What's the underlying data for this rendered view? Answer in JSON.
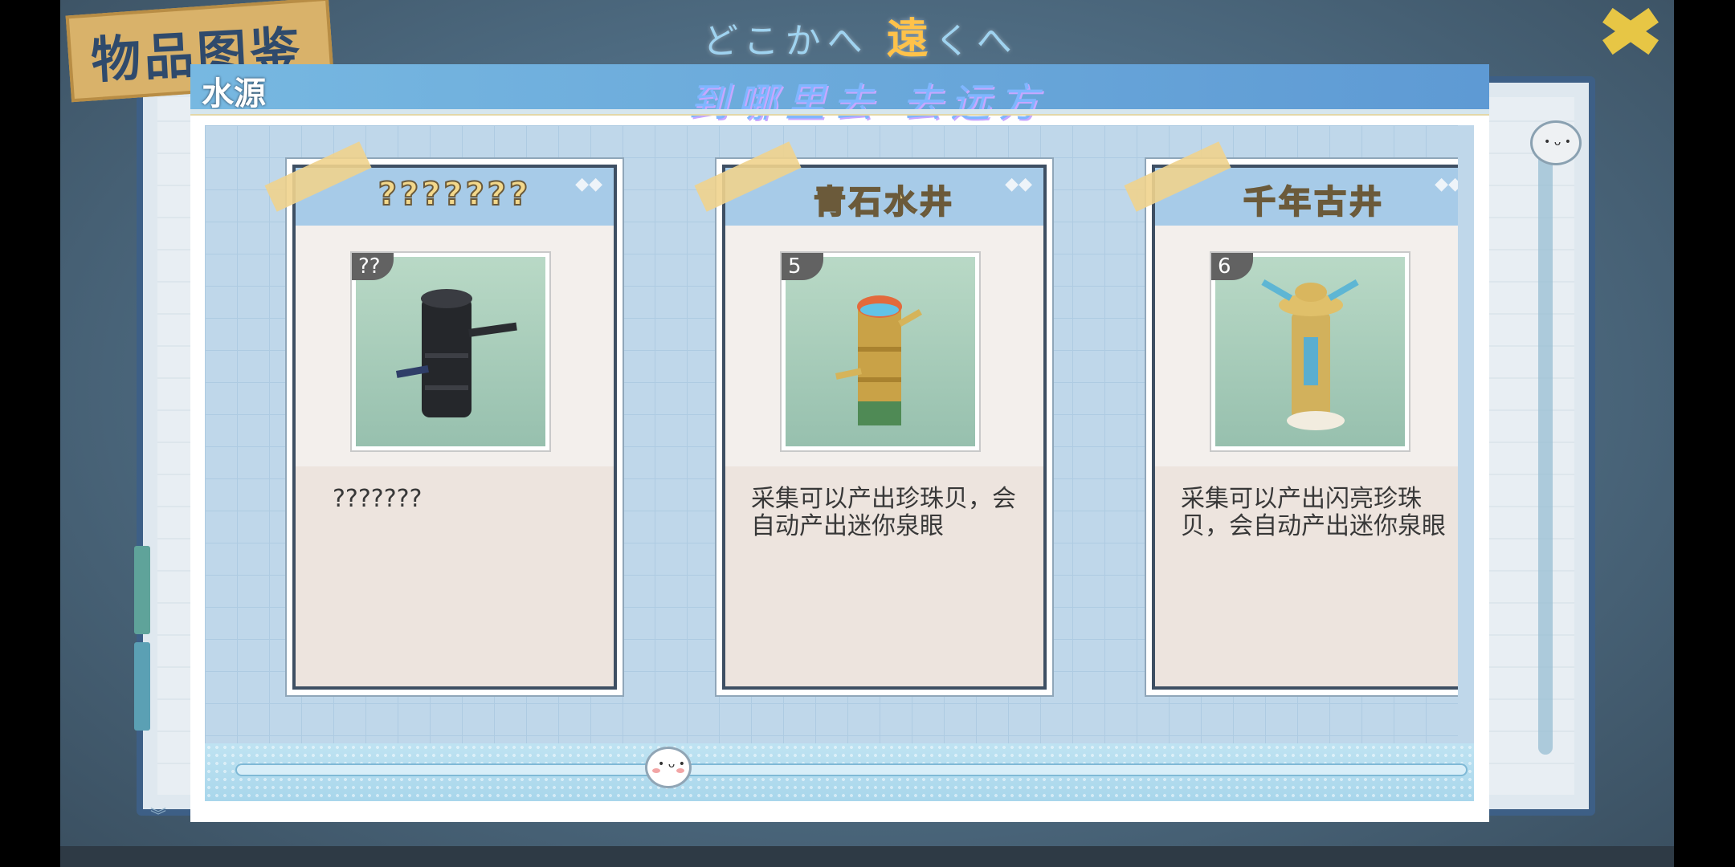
{
  "app": {
    "book_title": "物品图鉴",
    "song_jp": {
      "before": "どこかへ ",
      "highlight": "遠",
      "after": "くへ"
    },
    "song_cn": "到哪里去 去远方"
  },
  "dialog": {
    "title": "水源"
  },
  "cards": [
    {
      "name": "???????",
      "level": "??",
      "description": "???????",
      "locked": true
    },
    {
      "name": "青石水井",
      "level": "5",
      "description": "采集可以产出珍珠贝，会自动产出迷你泉眼",
      "locked": false
    },
    {
      "name": "千年古井",
      "level": "6",
      "description": "采集可以产出闪亮珍珠贝，会自动产出迷你泉眼",
      "locked": false
    }
  ],
  "slider": {
    "position_fraction": 0.33
  },
  "colors": {
    "header_blue": "#6aa9dc",
    "card_name_gold": "#f3d88b",
    "frame_navy": "#3e4f63"
  },
  "icons": {
    "diamond": "diamond-decor-icon",
    "mascot": "mascot-face-icon"
  }
}
